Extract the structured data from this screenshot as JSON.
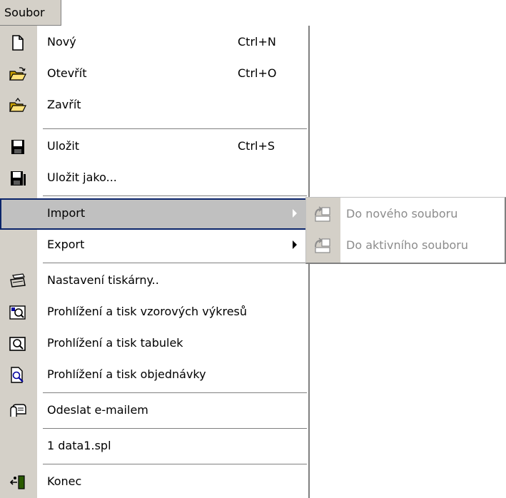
{
  "menubar": {
    "title": "Soubor"
  },
  "menu": {
    "items": [
      {
        "label": "Nový",
        "shortcut": "Ctrl+N",
        "icon": "new-file-icon"
      },
      {
        "label": "Otevřít",
        "shortcut": "Ctrl+O",
        "icon": "open-folder-icon"
      },
      {
        "label": "Zavřít",
        "shortcut": "",
        "icon": "close-folder-icon"
      },
      {
        "label": "Uložit",
        "shortcut": "Ctrl+S",
        "icon": "save-icon"
      },
      {
        "label": "Uložit jako...",
        "shortcut": "",
        "icon": "save-as-icon"
      },
      {
        "label": "Import",
        "shortcut": "",
        "icon": "",
        "submenu": true,
        "highlighted": true
      },
      {
        "label": "Export",
        "shortcut": "",
        "icon": "",
        "submenu": true
      },
      {
        "label": "Nastavení tiskárny..",
        "shortcut": "",
        "icon": "printer-icon"
      },
      {
        "label": "Prohlížení a tisk vzorových výkresů",
        "shortcut": "",
        "icon": "preview-drawings-icon"
      },
      {
        "label": "Prohlížení a tisk tabulek",
        "shortcut": "",
        "icon": "preview-tables-icon"
      },
      {
        "label": "Prohlížení a tisk objednávky",
        "shortcut": "",
        "icon": "preview-order-icon"
      },
      {
        "label": "Odeslat e-mailem",
        "shortcut": "",
        "icon": "email-icon"
      },
      {
        "label": "1 data1.spl",
        "shortcut": "",
        "icon": ""
      },
      {
        "label": "Konec",
        "shortcut": "",
        "icon": "exit-icon"
      }
    ]
  },
  "submenu": {
    "parent": "Import",
    "items": [
      {
        "label": "Do nového souboru",
        "icon": "import-new-icon",
        "disabled": true
      },
      {
        "label": "Do aktivního souboru",
        "icon": "import-active-icon",
        "disabled": true
      }
    ]
  },
  "colors": {
    "menu_face": "#d4d0c8",
    "highlight_border": "#0a246a",
    "highlight_fill": "#c0c0c0",
    "disabled_text": "#8c8c8c"
  }
}
